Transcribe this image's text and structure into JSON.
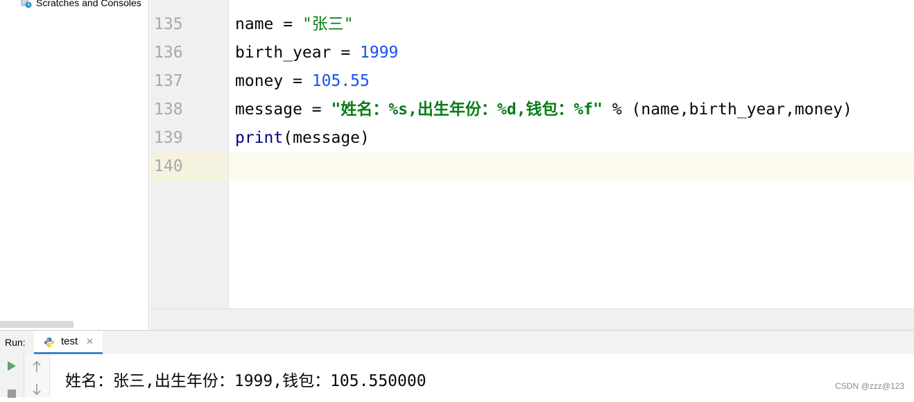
{
  "project_panel": {
    "scratches_label": "Scratches and Consoles"
  },
  "editor": {
    "lines": [
      {
        "num": "135"
      },
      {
        "num": "136"
      },
      {
        "num": "137"
      },
      {
        "num": "138"
      },
      {
        "num": "139"
      },
      {
        "num": "140"
      }
    ],
    "code": {
      "l135": {
        "var": "name = ",
        "str": "\"张三\""
      },
      "l136": {
        "var": "birth_year = ",
        "num": "1999"
      },
      "l137": {
        "var": "money = ",
        "num": "105.55"
      },
      "l138": {
        "var": "message = ",
        "str": "\"姓名：%s,出生年份：%d,钱包：%f\"",
        "rest": " % (name,birth_year,money)"
      },
      "l139": {
        "builtin": "print",
        "rest": "(message)"
      }
    }
  },
  "run": {
    "label": "Run:",
    "tab_label": "test",
    "tab_close": "✕",
    "output": "姓名：张三,出生年份：1999,钱包：105.550000"
  },
  "watermark": "CSDN @zzz@123",
  "colors": {
    "string": "#067d17",
    "number": "#1750eb",
    "builtin": "#000080",
    "tab_underline": "#4083c9"
  }
}
